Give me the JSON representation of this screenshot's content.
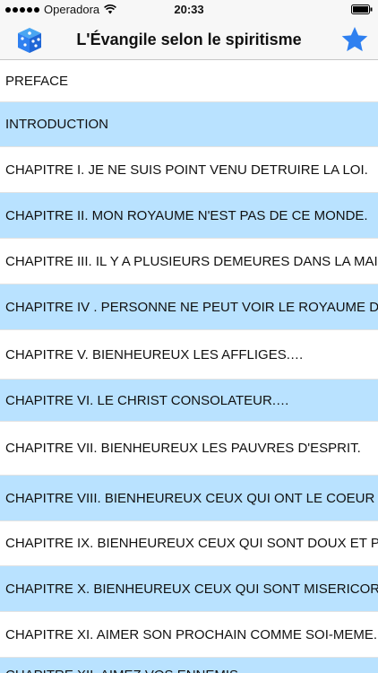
{
  "status_bar": {
    "carrier": "Operadora",
    "time": "20:33"
  },
  "nav": {
    "title": "L'Évangile selon le spiritisme",
    "left_icon": "dice-icon",
    "right_icon": "star-icon",
    "accent_color": "#2f80f0"
  },
  "chapters": [
    "PREFACE",
    "INTRODUCTION",
    "CHAPITRE I. JE NE SUIS POINT VENU DETRUIRE LA LOI.",
    "CHAPITRE II. MON ROYAUME N'EST PAS DE CE MONDE.",
    "CHAPITRE III. IL Y A PLUSIEURS DEMEURES DANS LA MAISON",
    "CHAPITRE IV . PERSONNE NE PEUT VOIR LE ROYAUME DE DIEU",
    "CHAPITRE V. BIENHEUREUX LES AFFLIGES.…",
    "CHAPITRE VI. LE CHRIST CONSOLATEUR.…",
    "CHAPITRE VII. BIENHEUREUX LES PAUVRES D'ESPRIT.",
    "CHAPITRE VIII. BIENHEUREUX CEUX QUI ONT LE COEUR PUR",
    "CHAPITRE IX. BIENHEUREUX CEUX QUI SONT DOUX ET PACIFIQUES",
    "CHAPITRE X. BIENHEUREUX CEUX QUI SONT MISERICORDIEUX",
    "CHAPITRE XI. AIMER SON PROCHAIN COMME SOI-MEME.",
    "CHAPITRE XII. AIMEZ VOS ENNEMIS"
  ],
  "colors": {
    "row_alt": "#b9e2ff",
    "row_plain": "#ffffff",
    "bar_bg": "#f7f7f7"
  }
}
